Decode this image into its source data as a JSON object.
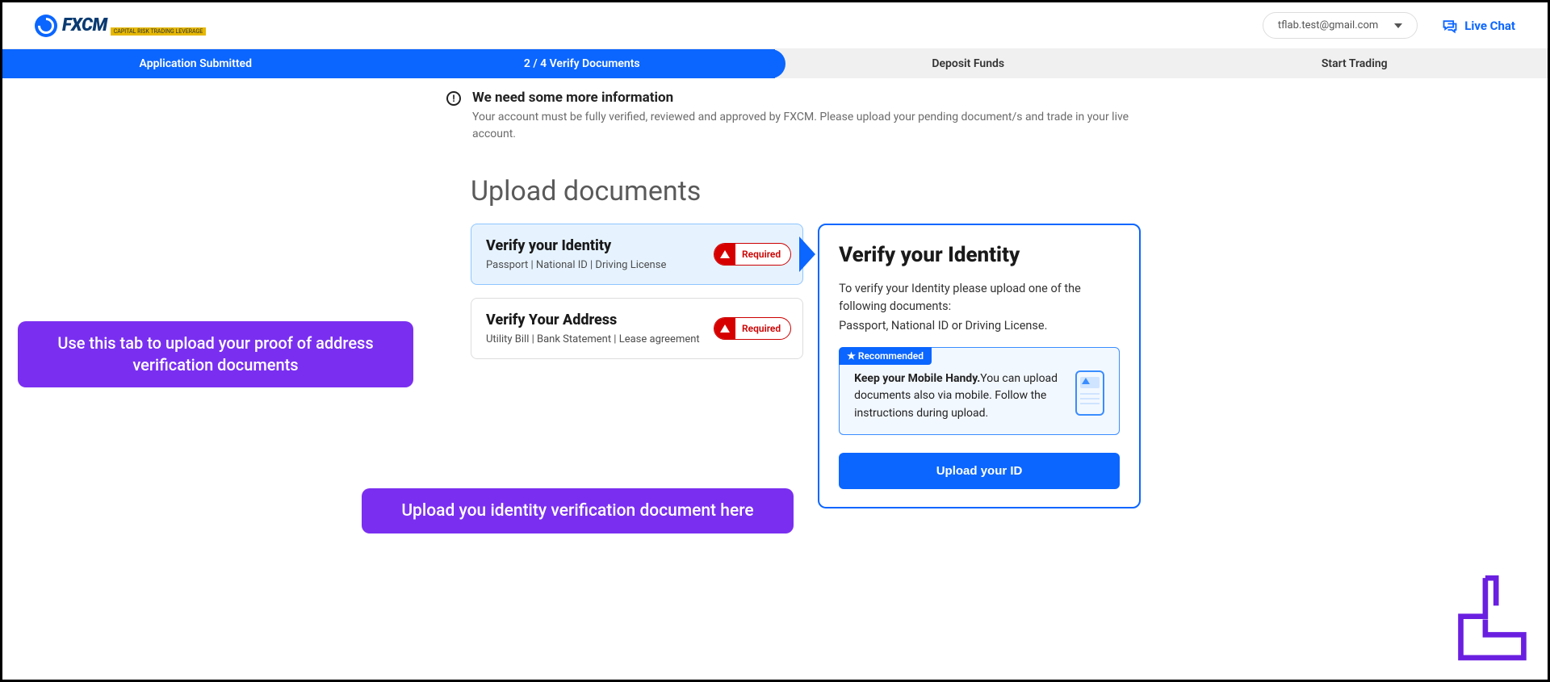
{
  "header": {
    "logo_text": "FXCM",
    "logo_sub": "CAPITAL RISK TRADING LEVERAGE",
    "user_email": "tflab.test@gmail.com",
    "live_chat": "Live Chat"
  },
  "progress": {
    "steps": [
      "Application Submitted",
      "2 / 4  Verify Documents",
      "Deposit Funds",
      "Start Trading"
    ],
    "active_index": 1
  },
  "info": {
    "title": "We need some more information",
    "desc": "Your account must be fully verified, reviewed and approved by FXCM. Please upload your pending document/s and trade in your live account."
  },
  "section_title": "Upload documents",
  "tabs": {
    "identity": {
      "title": "Verify your Identity",
      "sub": "Passport | National ID | Driving License",
      "badge": "Required"
    },
    "address": {
      "title": "Verify Your Address",
      "sub": "Utility Bill | Bank Statement | Lease agreement",
      "badge": "Required"
    }
  },
  "panel": {
    "title": "Verify your Identity",
    "desc1": "To verify your Identity please upload one of the following documents:",
    "desc2": "Passport, National ID or Driving License.",
    "reco_label": "★ Recommended",
    "reco_bold": "Keep your Mobile Handy.",
    "reco_rest": "You can upload documents also via mobile. Follow the instructions during upload.",
    "upload_btn": "Upload your ID"
  },
  "callouts": {
    "c1": "Use this tab to upload your proof of address verification documents",
    "c2": "Upload you identity verification document here"
  }
}
